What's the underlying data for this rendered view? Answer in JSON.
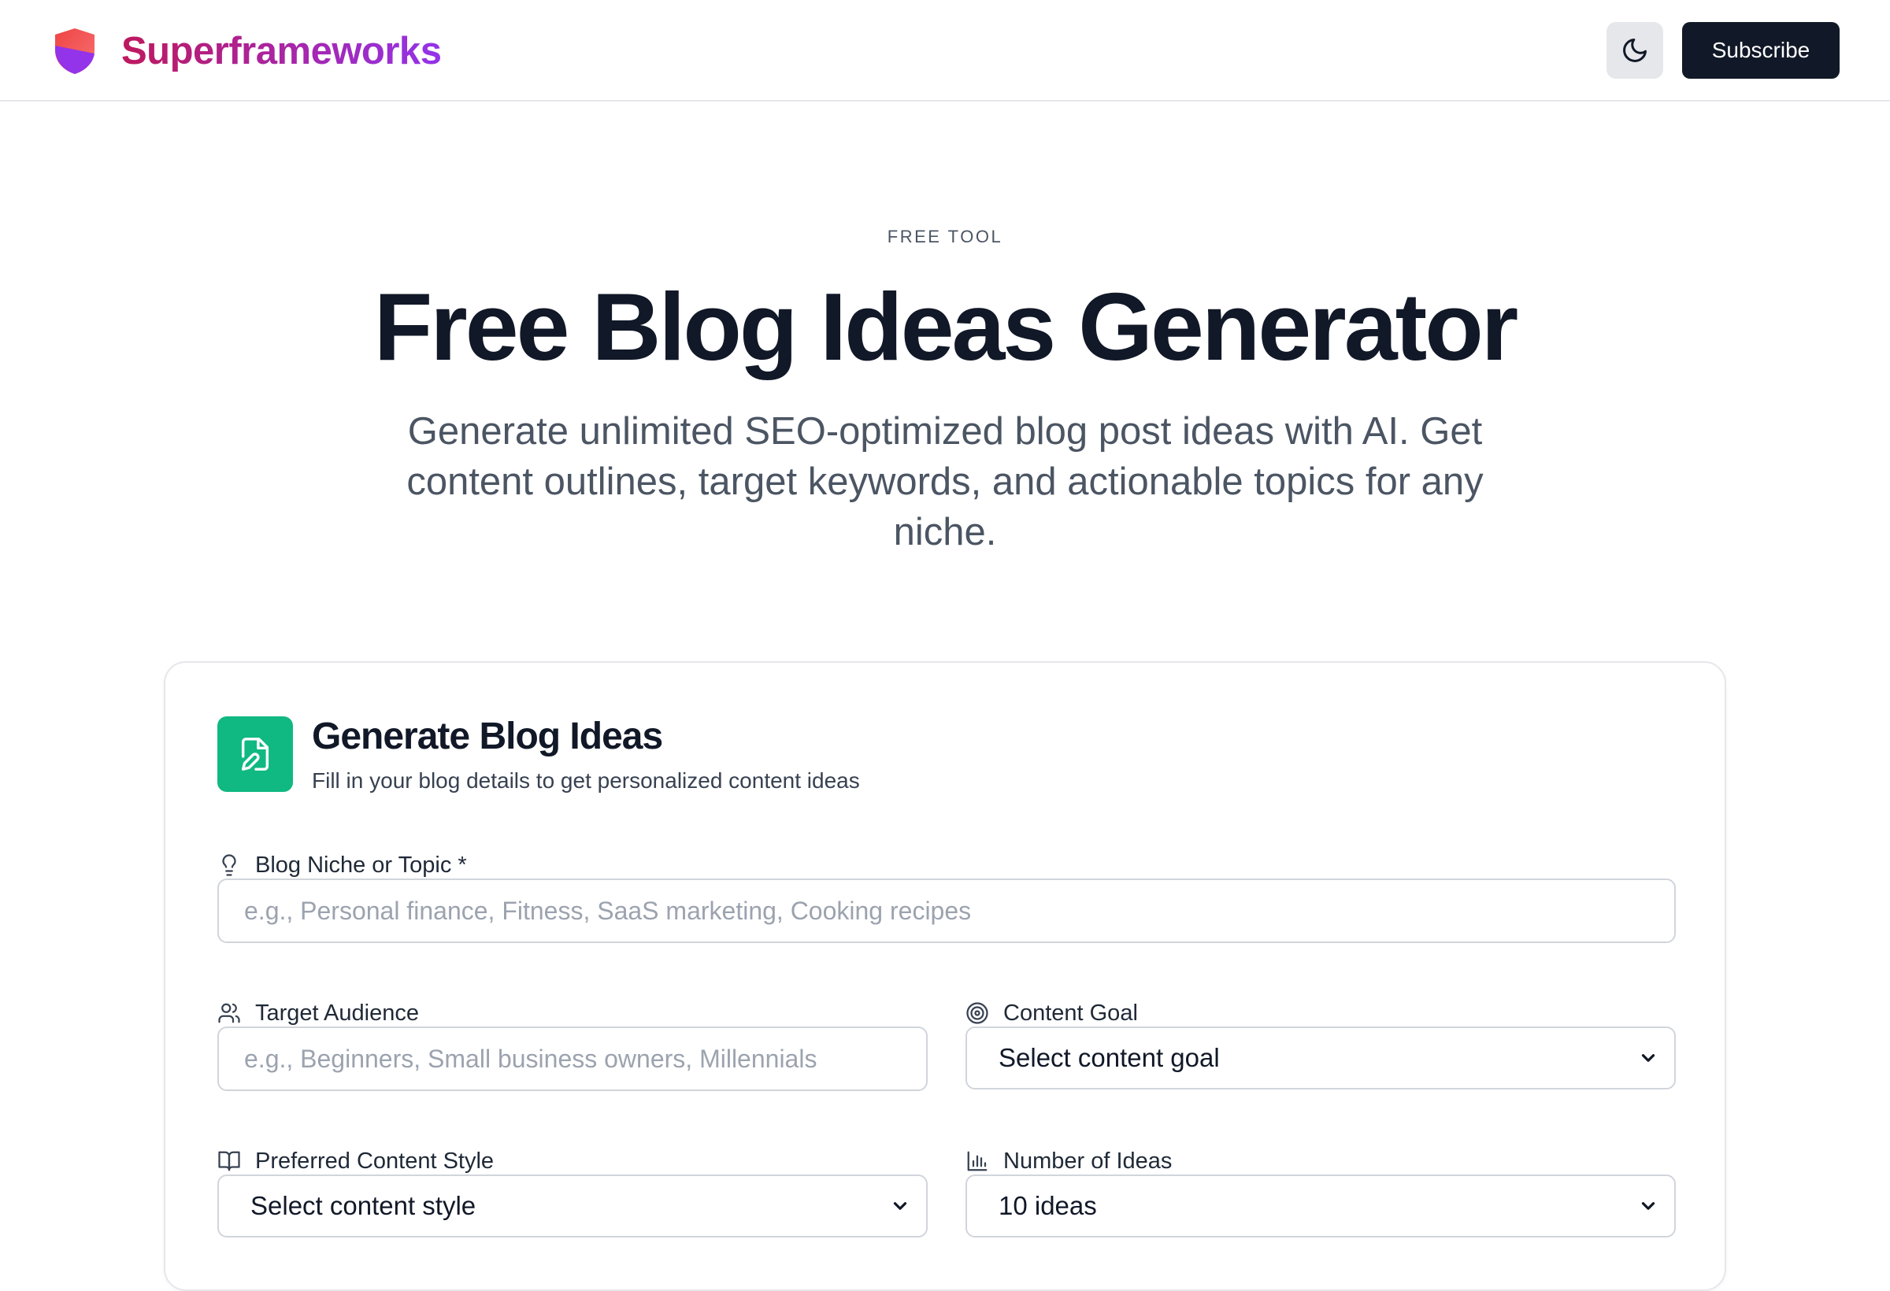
{
  "header": {
    "brand_name": "Superframeworks",
    "subscribe_label": "Subscribe",
    "theme_icon": "moon-icon",
    "brand_colors": [
      "#ef4444",
      "#9333ea"
    ]
  },
  "hero": {
    "eyebrow": "FREE TOOL",
    "title": "Free Blog Ideas Generator",
    "subtitle": "Generate unlimited SEO-optimized blog post ideas with AI. Get content outlines, target keywords, and actionable topics for any niche."
  },
  "form": {
    "title": "Generate Blog Ideas",
    "subtitle": "Fill in your blog details to get personalized content ideas",
    "icon": "file-edit-icon",
    "accent_color": "#10b981",
    "niche": {
      "label": "Blog Niche or Topic *",
      "placeholder": "e.g., Personal finance, Fitness, SaaS marketing, Cooking recipes",
      "value": "",
      "icon": "lightbulb-icon"
    },
    "audience": {
      "label": "Target Audience",
      "placeholder": "e.g., Beginners, Small business owners, Millennials",
      "value": "",
      "icon": "users-icon"
    },
    "goal": {
      "label": "Content Goal",
      "selected": "Select content goal",
      "icon": "target-icon"
    },
    "style": {
      "label": "Preferred Content Style",
      "selected": "Select content style",
      "icon": "book-open-icon"
    },
    "count": {
      "label": "Number of Ideas",
      "selected": "10 ideas",
      "icon": "bar-chart-icon"
    }
  }
}
